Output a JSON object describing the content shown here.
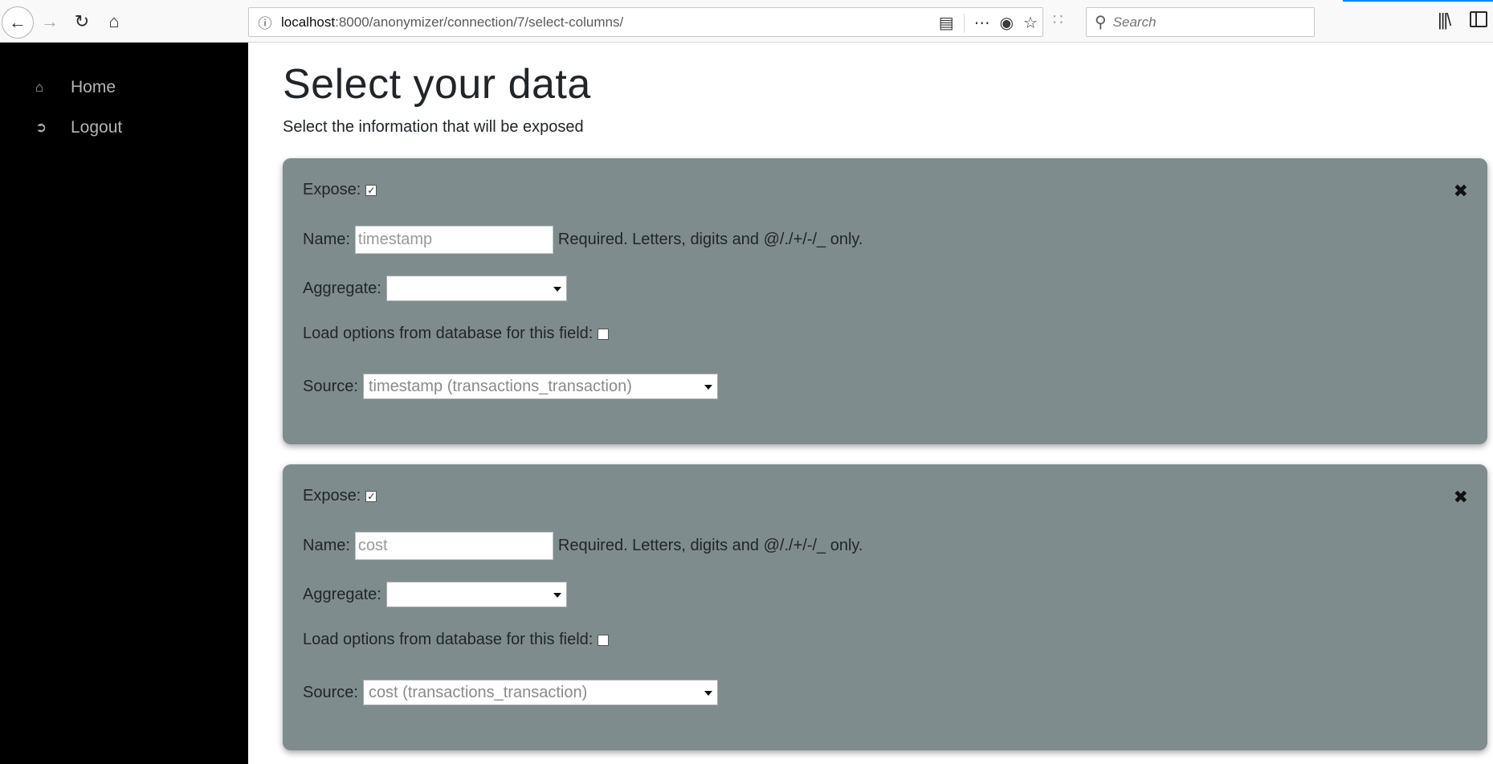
{
  "browser": {
    "url_host": "localhost",
    "url_path": ":8000/anonymizer/connection/7/select-columns/",
    "search_placeholder": "Search"
  },
  "sidebar": {
    "items": [
      {
        "label": "Home",
        "icon": "home-icon"
      },
      {
        "label": "Logout",
        "icon": "logout-icon"
      }
    ]
  },
  "page": {
    "title": "Select your data",
    "subtitle": "Select the information that will be exposed"
  },
  "labels": {
    "expose": "Expose:",
    "name": "Name:",
    "help": "Required. Letters, digits and @/./+/-/_ only.",
    "aggregate": "Aggregate:",
    "load_options": "Load options from database for this field:",
    "source": "Source:"
  },
  "columns": [
    {
      "expose": true,
      "name_placeholder": "timestamp",
      "aggregate": "",
      "load_options": false,
      "source": "timestamp (transactions_transaction)"
    },
    {
      "expose": true,
      "name_placeholder": "cost",
      "aggregate": "",
      "load_options": false,
      "source": "cost (transactions_transaction)"
    }
  ],
  "colors": {
    "card": "#7f8c8d",
    "sidebar": "#000000"
  }
}
